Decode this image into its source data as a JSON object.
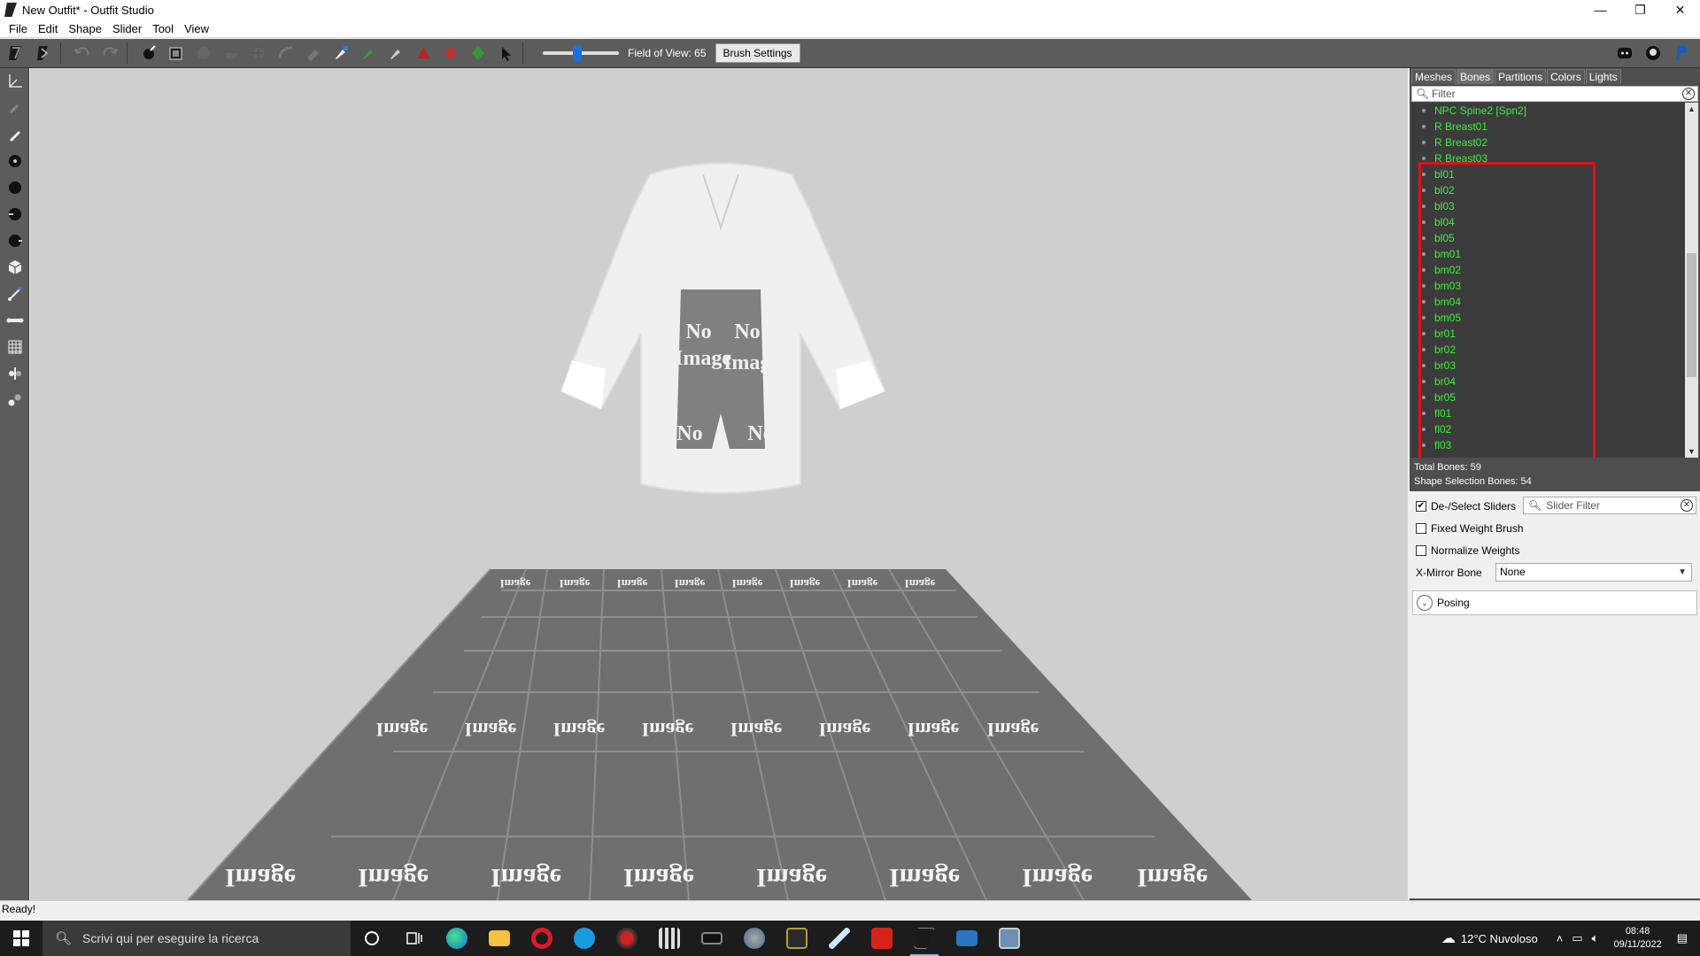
{
  "window": {
    "title": "New Outfit* - Outfit Studio",
    "minimize": "—",
    "restore": "❐",
    "close": "✕"
  },
  "menu": [
    "File",
    "Edit",
    "Shape",
    "Slider",
    "Tool",
    "View"
  ],
  "toolbar": {
    "fov_label": "Field of View: 65",
    "fov_value": 65,
    "brush_settings_label": "Brush Settings"
  },
  "right_panel": {
    "tabs": [
      "Meshes",
      "Bones",
      "Partitions",
      "Colors",
      "Lights"
    ],
    "active_tab": "Bones",
    "filter_placeholder": "Filter",
    "bones": [
      "NPC Spine2 [Spn2]",
      "R Breast01",
      "R Breast02",
      "R Breast03",
      "bl01",
      "bl02",
      "bl03",
      "bl04",
      "bl05",
      "bm01",
      "bm02",
      "bm03",
      "bm04",
      "bm05",
      "br01",
      "br02",
      "br03",
      "br04",
      "br05",
      "fl01",
      "fl02",
      "fl03"
    ],
    "total_bones": "Total Bones: 59",
    "shape_selection_bones": "Shape Selection Bones: 54",
    "deselect_sliders_label": "De-/Select Sliders",
    "deselect_sliders_checked": true,
    "slider_filter_placeholder": "Slider Filter",
    "fixed_weight_brush_label": "Fixed Weight Brush",
    "fixed_weight_brush_checked": false,
    "normalize_weights_label": "Normalize Weights",
    "normalize_weights_checked": false,
    "x_mirror_bone_label": "X-Mirror Bone",
    "x_mirror_bone_value": "None",
    "posing_label": "Posing"
  },
  "viewport": {
    "floor_texture_text_line1": "No",
    "floor_texture_text_line2": "Image"
  },
  "status": "Ready!",
  "taskbar": {
    "search_placeholder": "Scrivi qui per eseguire la ricerca",
    "weather": "12°C  Nuvoloso",
    "time": "08:48",
    "date": "09/11/2022"
  },
  "colors": {
    "bone_text": "#3cf03c",
    "highlight": "#e0101a",
    "toolbar_bg": "#5c5c5c",
    "viewport_bg": "#cfcfcf"
  }
}
